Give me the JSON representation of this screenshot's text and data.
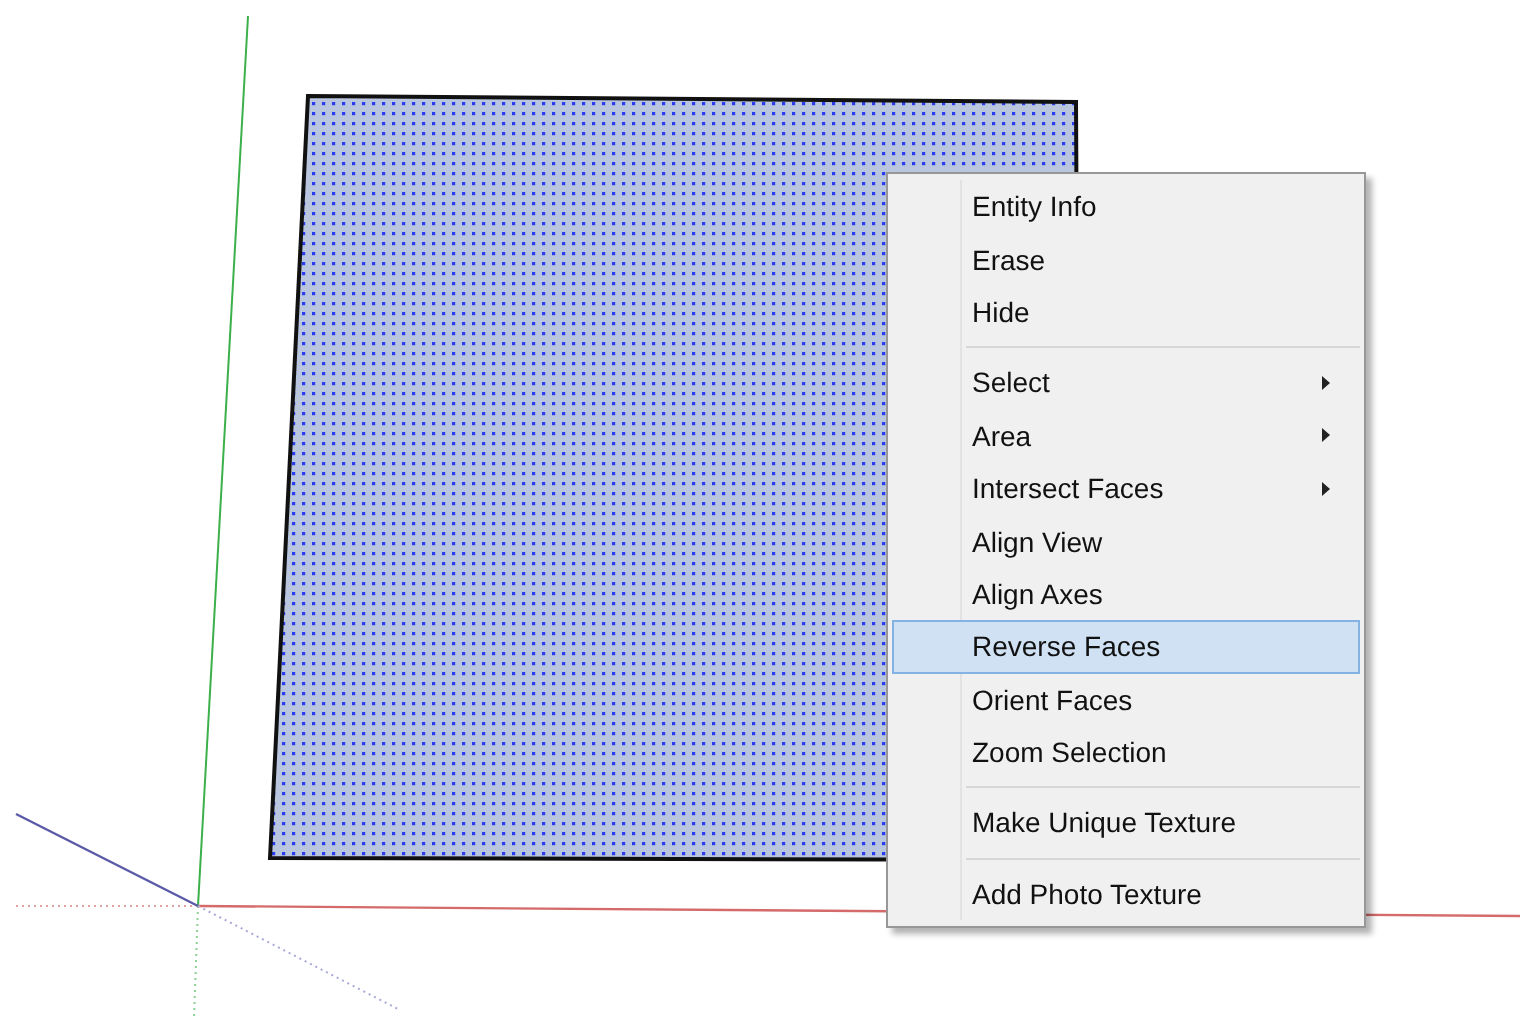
{
  "context_menu": {
    "items": [
      {
        "kind": "item",
        "label": "Entity Info",
        "has_submenu": false,
        "selected": false
      },
      {
        "kind": "item",
        "label": "Erase",
        "has_submenu": false,
        "selected": false
      },
      {
        "kind": "item",
        "label": "Hide",
        "has_submenu": false,
        "selected": false
      },
      {
        "kind": "separator"
      },
      {
        "kind": "item",
        "label": "Select",
        "has_submenu": true,
        "selected": false
      },
      {
        "kind": "item",
        "label": "Area",
        "has_submenu": true,
        "selected": false
      },
      {
        "kind": "item",
        "label": "Intersect Faces",
        "has_submenu": true,
        "selected": false
      },
      {
        "kind": "item",
        "label": "Align View",
        "has_submenu": false,
        "selected": false
      },
      {
        "kind": "item",
        "label": "Align Axes",
        "has_submenu": false,
        "selected": false
      },
      {
        "kind": "item",
        "label": "Reverse Faces",
        "has_submenu": false,
        "selected": true
      },
      {
        "kind": "item",
        "label": "Orient Faces",
        "has_submenu": false,
        "selected": false
      },
      {
        "kind": "item",
        "label": "Zoom Selection",
        "has_submenu": false,
        "selected": false
      },
      {
        "kind": "separator"
      },
      {
        "kind": "item",
        "label": "Make Unique Texture",
        "has_submenu": false,
        "selected": false
      },
      {
        "kind": "separator"
      },
      {
        "kind": "item",
        "label": "Add Photo Texture",
        "has_submenu": false,
        "selected": false
      }
    ]
  }
}
